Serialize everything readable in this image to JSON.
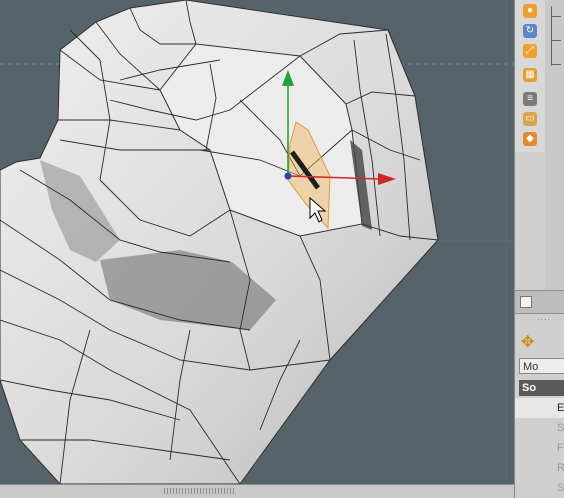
{
  "right_panel": {
    "mode_label": "Mo",
    "section_label": "So",
    "list_items": [
      "E",
      "S",
      "F",
      "R",
      "S"
    ],
    "tool_icons": [
      "axis-icon",
      "rotate-icon",
      "scale-icon",
      "grid-icon",
      "layers-icon",
      "cube-icon"
    ]
  },
  "colors": {
    "viewport_bg": "#57636b",
    "mesh": "#d9d9d9",
    "axis_y": "#21a33a",
    "axis_x": "#d02626",
    "axis_z": "#2244bb",
    "selection_fill": "#f0b35a"
  }
}
